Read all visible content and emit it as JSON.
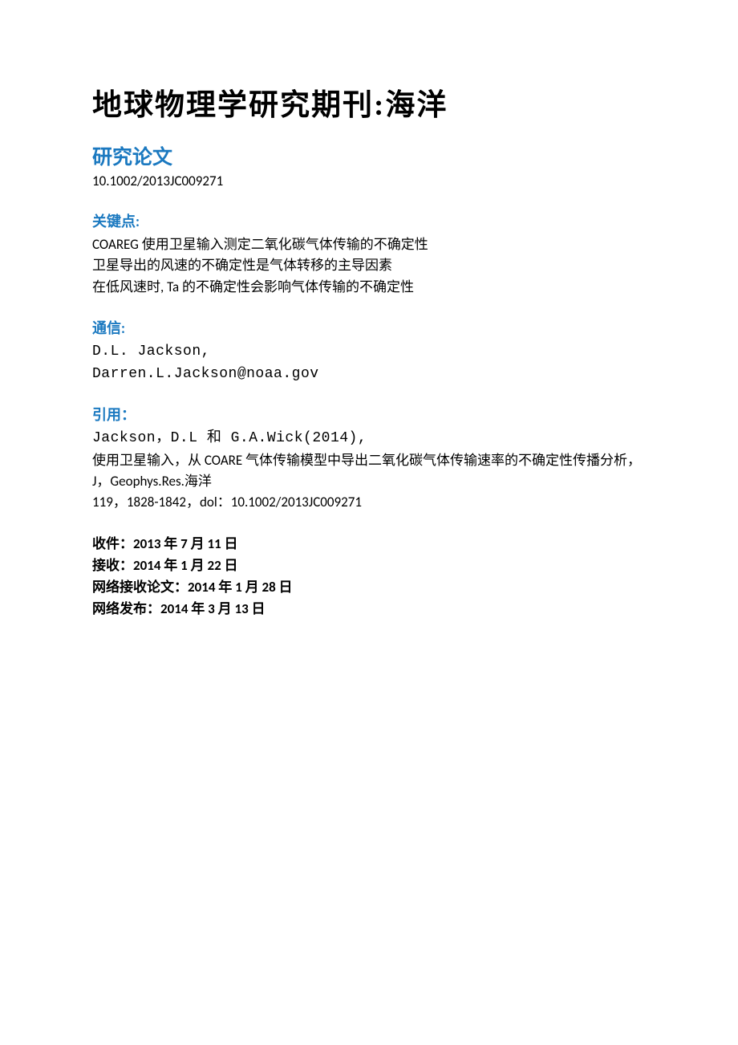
{
  "journal_title": "地球物理学研究期刊:海洋",
  "article_type": "研究论文",
  "doi": "10.1002/2013JC009271",
  "keypoints": {
    "heading": "关键点:",
    "items": [
      "COAREG 使用卫星输入测定二氧化碳气体传输的不确定性",
      "卫星导出的风速的不确定性是气体转移的主导因素",
      "在低风速时, Ta 的不确定性会影响气体传输的不确定性"
    ]
  },
  "correspondence": {
    "heading": "通信:",
    "name": "D.L.  Jackson,",
    "email": "Darren.L.Jackson@noaa.gov"
  },
  "citation": {
    "heading": "引用：",
    "authors": "Jackson，D.L 和 G.A.Wick(2014),",
    "title": "使用卫星输入，从 COARE 气体传输模型中导出二氧化碳气体传输速率的不确定性传播分析，",
    "journal_ref": "J，Geophys.Res.海洋",
    "vol_pages_doi": "119，1828-1842，dol：10.1002/2013JC009271"
  },
  "dates": {
    "received": {
      "label": "收件：",
      "value": "2013 年 7 月 11 日"
    },
    "accepted": {
      "label": "接收：",
      "value": "2014 年 1 月 22 日"
    },
    "accepted_online": {
      "label": "网络接收论文：",
      "value": "2014 年 1 月 28  日"
    },
    "published_online": {
      "label": "网络发布：",
      "value": "2014 年 3 月 13 日"
    }
  }
}
